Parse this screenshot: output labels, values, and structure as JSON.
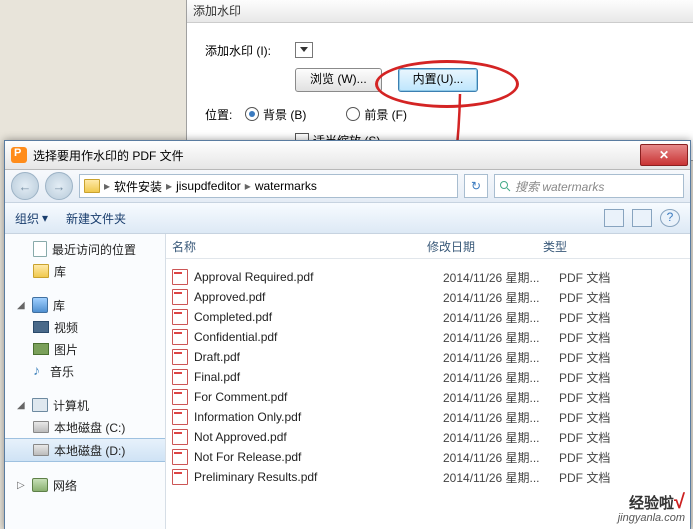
{
  "bg_dialog": {
    "title": "添加水印",
    "add_label": "添加水印 (I):",
    "browse_btn": "浏览 (W)...",
    "builtin_btn": "内置(U)...",
    "position_label": "位置:",
    "bg_radio": "背景 (B)",
    "fg_radio": "前景 (F)",
    "scale_cb": "适当缩放 (S)"
  },
  "file_dialog": {
    "title": "选择要用作水印的 PDF 文件",
    "breadcrumb": [
      "软件安装",
      "jisupdfeditor",
      "watermarks"
    ],
    "search_placeholder": "搜索 watermarks",
    "toolbar": {
      "organize": "组织",
      "new_folder": "新建文件夹"
    },
    "columns": {
      "name": "名称",
      "date": "修改日期",
      "type": "类型"
    },
    "tree": {
      "recent": "最近访问的位置",
      "libraries1": "库",
      "libraries2": "库",
      "video": "视频",
      "pictures": "图片",
      "music": "音乐",
      "computer": "计算机",
      "drive_c": "本地磁盘 (C:)",
      "drive_d": "本地磁盘 (D:)",
      "network": "网络"
    },
    "files": [
      {
        "name": "Approval Required.pdf",
        "date": "2014/11/26 星期...",
        "type": "PDF 文档"
      },
      {
        "name": "Approved.pdf",
        "date": "2014/11/26 星期...",
        "type": "PDF 文档"
      },
      {
        "name": "Completed.pdf",
        "date": "2014/11/26 星期...",
        "type": "PDF 文档"
      },
      {
        "name": "Confidential.pdf",
        "date": "2014/11/26 星期...",
        "type": "PDF 文档"
      },
      {
        "name": "Draft.pdf",
        "date": "2014/11/26 星期...",
        "type": "PDF 文档"
      },
      {
        "name": "Final.pdf",
        "date": "2014/11/26 星期...",
        "type": "PDF 文档"
      },
      {
        "name": "For Comment.pdf",
        "date": "2014/11/26 星期...",
        "type": "PDF 文档"
      },
      {
        "name": "Information Only.pdf",
        "date": "2014/11/26 星期...",
        "type": "PDF 文档"
      },
      {
        "name": "Not Approved.pdf",
        "date": "2014/11/26 星期...",
        "type": "PDF 文档"
      },
      {
        "name": "Not For Release.pdf",
        "date": "2014/11/26 星期...",
        "type": "PDF 文档"
      },
      {
        "name": "Preliminary Results.pdf",
        "date": "2014/11/26 星期...",
        "type": "PDF 文档"
      }
    ]
  },
  "watermark": {
    "line1": "经验啦",
    "line2": "jingyanla.com"
  }
}
